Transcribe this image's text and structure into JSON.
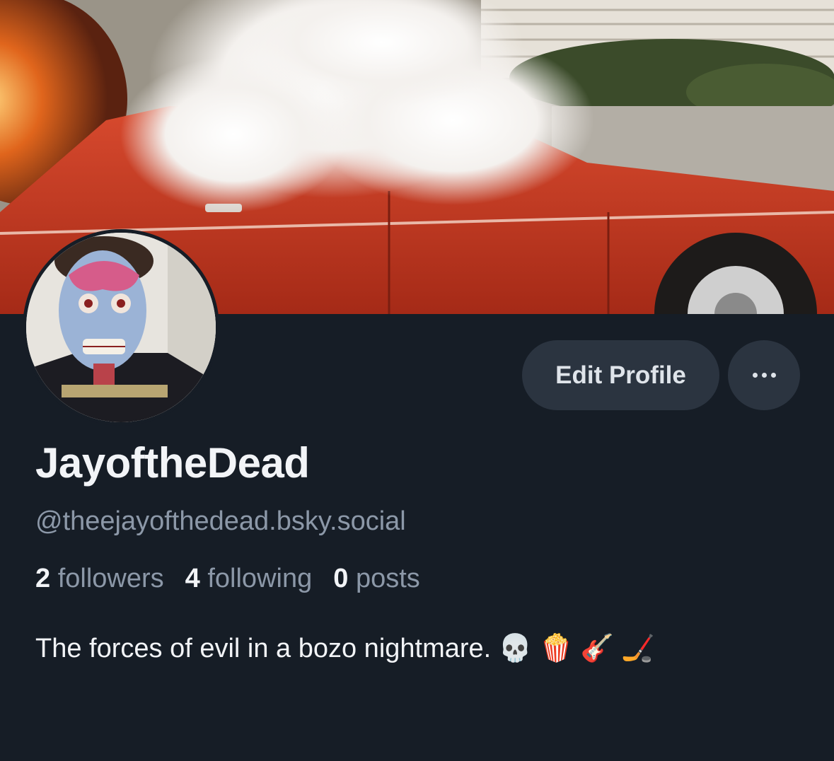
{
  "profile": {
    "display_name": "JayoftheDead",
    "handle": "@theejayofthedead.bsky.social",
    "stats": {
      "followers_count": "2",
      "followers_label": "followers",
      "following_count": "4",
      "following_label": "following",
      "posts_count": "0",
      "posts_label": "posts"
    },
    "bio": "The forces of evil in a bozo nightmare. 💀 🍿 🎸 🏒"
  },
  "actions": {
    "edit_profile_label": "Edit Profile",
    "more_icon": "ellipsis-icon"
  },
  "colors": {
    "background": "#161d26",
    "button_bg": "#2b3440",
    "primary_text": "#f2f4f7",
    "secondary_text": "#8c98a8"
  }
}
